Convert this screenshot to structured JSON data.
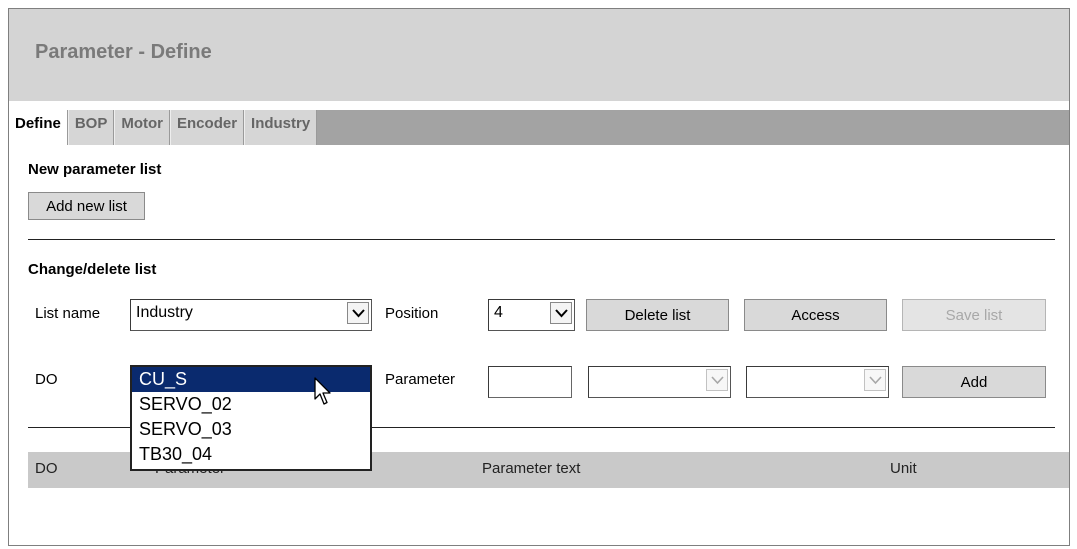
{
  "page": {
    "title": "Parameter - Define"
  },
  "tabs": [
    "Define",
    "BOP",
    "Motor",
    "Encoder",
    "Industry"
  ],
  "new_list": {
    "heading": "New parameter list",
    "add_button": "Add new list"
  },
  "change_list": {
    "heading": "Change/delete list",
    "list_name_label": "List name",
    "list_name_value": "Industry",
    "position_label": "Position",
    "position_value": "4",
    "delete_button": "Delete list",
    "access_button": "Access",
    "save_button": "Save list"
  },
  "do_row": {
    "do_label": "DO",
    "parameter_label": "Parameter",
    "parameter_value": "",
    "add_button": "Add"
  },
  "do_dropdown": {
    "options": [
      "CU_S",
      "SERVO_02",
      "SERVO_03",
      "TB30_04"
    ],
    "selected": "CU_S"
  },
  "table": {
    "headers": {
      "do": "DO",
      "parameter": "Parameter",
      "text": "Parameter text",
      "unit": "Unit"
    }
  },
  "colors": {
    "title_bar": "#d4d4d4",
    "tab_strip": "#a3a3a3",
    "selection": "#0a2a6e"
  },
  "icons": [
    "chevron-down-icon",
    "mouse-pointer-icon"
  ]
}
